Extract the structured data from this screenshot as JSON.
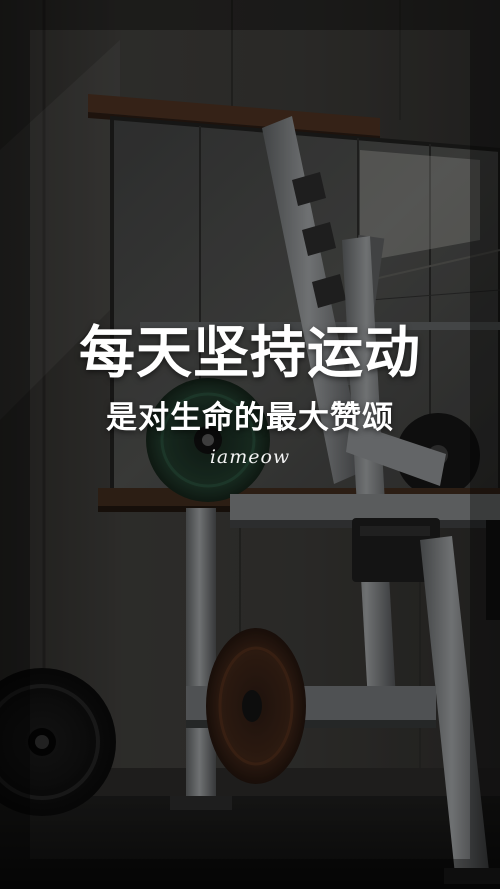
{
  "poster": {
    "title": "每天坚持运动",
    "subtitle": "是对生命的最大赞颂",
    "signature": "iameow"
  },
  "colors": {
    "text": "#ffffff",
    "wall": "#3b3a37",
    "floor": "#141414",
    "wood_shelf": "#4a3020",
    "weight_plate_green": "#1f3a2c",
    "weight_plate_red": "#3a2216",
    "rack_metal": "#8a8d8f"
  }
}
